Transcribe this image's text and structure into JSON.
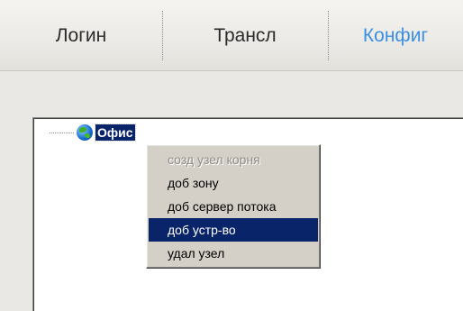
{
  "tabs": [
    {
      "label": "Логин",
      "active": false
    },
    {
      "label": "Трансл",
      "active": false
    },
    {
      "label": "Конфиг",
      "active": true
    }
  ],
  "tree": {
    "root": {
      "label": "Офис",
      "icon": "globe-icon",
      "selected": true
    }
  },
  "context_menu": {
    "items": [
      {
        "label": "созд узел корня",
        "enabled": false
      },
      {
        "label": "доб зону",
        "enabled": true
      },
      {
        "label": "доб сервер потока",
        "enabled": true
      },
      {
        "label": "доб устр-во",
        "enabled": true,
        "highlighted": true
      },
      {
        "label": "удал узел",
        "enabled": true
      }
    ]
  },
  "colors": {
    "active_tab": "#3b8fe0",
    "selection": "#0a246a",
    "menu_bg": "#d4d0c8"
  }
}
